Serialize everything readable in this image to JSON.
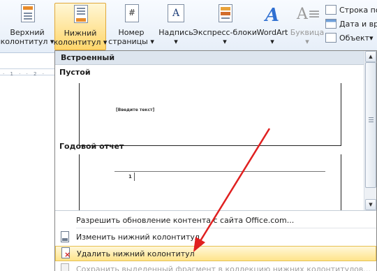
{
  "ribbon": {
    "header_top": {
      "label1": "Верхний",
      "label2": "колонтитул"
    },
    "header_bottom": {
      "label1": "Нижний",
      "label2": "колонтитул"
    },
    "page_number": {
      "label1": "Номер",
      "label2": "страницы"
    },
    "text_box": {
      "label": "Надпись"
    },
    "quick_parts": {
      "label": "Экспресс-блоки"
    },
    "wordart": {
      "label": "WordArt"
    },
    "drop_cap": {
      "label": "Буквица"
    },
    "small": {
      "signature_line": "Строка по",
      "date_time": "Дата и вре",
      "object": "Объект"
    }
  },
  "ruler": {
    "ticks": "· 1 · · 2 ·"
  },
  "menu": {
    "header": "Встроенный",
    "section_blank": "Пустой",
    "blank_placeholder": "[Введите текст]",
    "section_annual": "Годовой отчет",
    "annual_page_num": "1",
    "commands": {
      "update": "Разрешить обновление контента с сайта Office.com...",
      "edit": "Изменить нижний колонтитул",
      "remove": "Удалить нижний колонтитул",
      "save": "Сохранить выделенный фрагмент в коллекцию нижних колонтитулов..."
    }
  },
  "colors": {
    "accent": "#ffd66b",
    "arrow": "#e02020"
  }
}
